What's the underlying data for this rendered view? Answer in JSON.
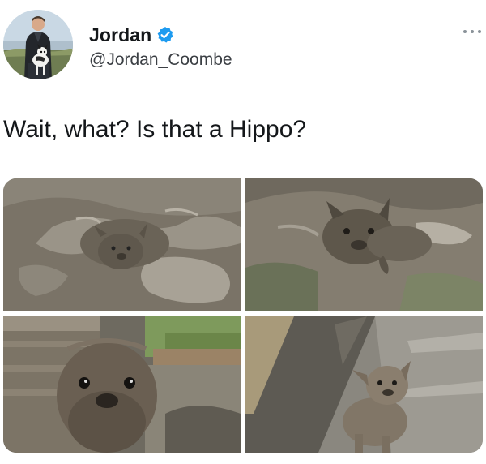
{
  "user": {
    "display_name": "Jordan",
    "handle": "@Jordan_Coombe",
    "verified": true,
    "avatar_icon": "profile-photo-man-with-dog"
  },
  "tweet": {
    "text": "Wait, what? Is that a Hippo?"
  },
  "photos": [
    {
      "label": "photo-1",
      "subject": "muddy dog in mud pool, head above water"
    },
    {
      "label": "photo-2",
      "subject": "mud covered french bulldog swimming"
    },
    {
      "label": "photo-3",
      "subject": "close-up of mud covered dog face"
    },
    {
      "label": "photo-4",
      "subject": "mud covered french bulldog on rocky slope"
    }
  ],
  "colors": {
    "verified_blue": "#1d9bf0",
    "text_primary": "#14171a",
    "text_secondary": "#3b3f44",
    "mud": "#7d7669"
  },
  "icons": {
    "verified": "verified-badge-icon",
    "more": "more-options-icon"
  }
}
